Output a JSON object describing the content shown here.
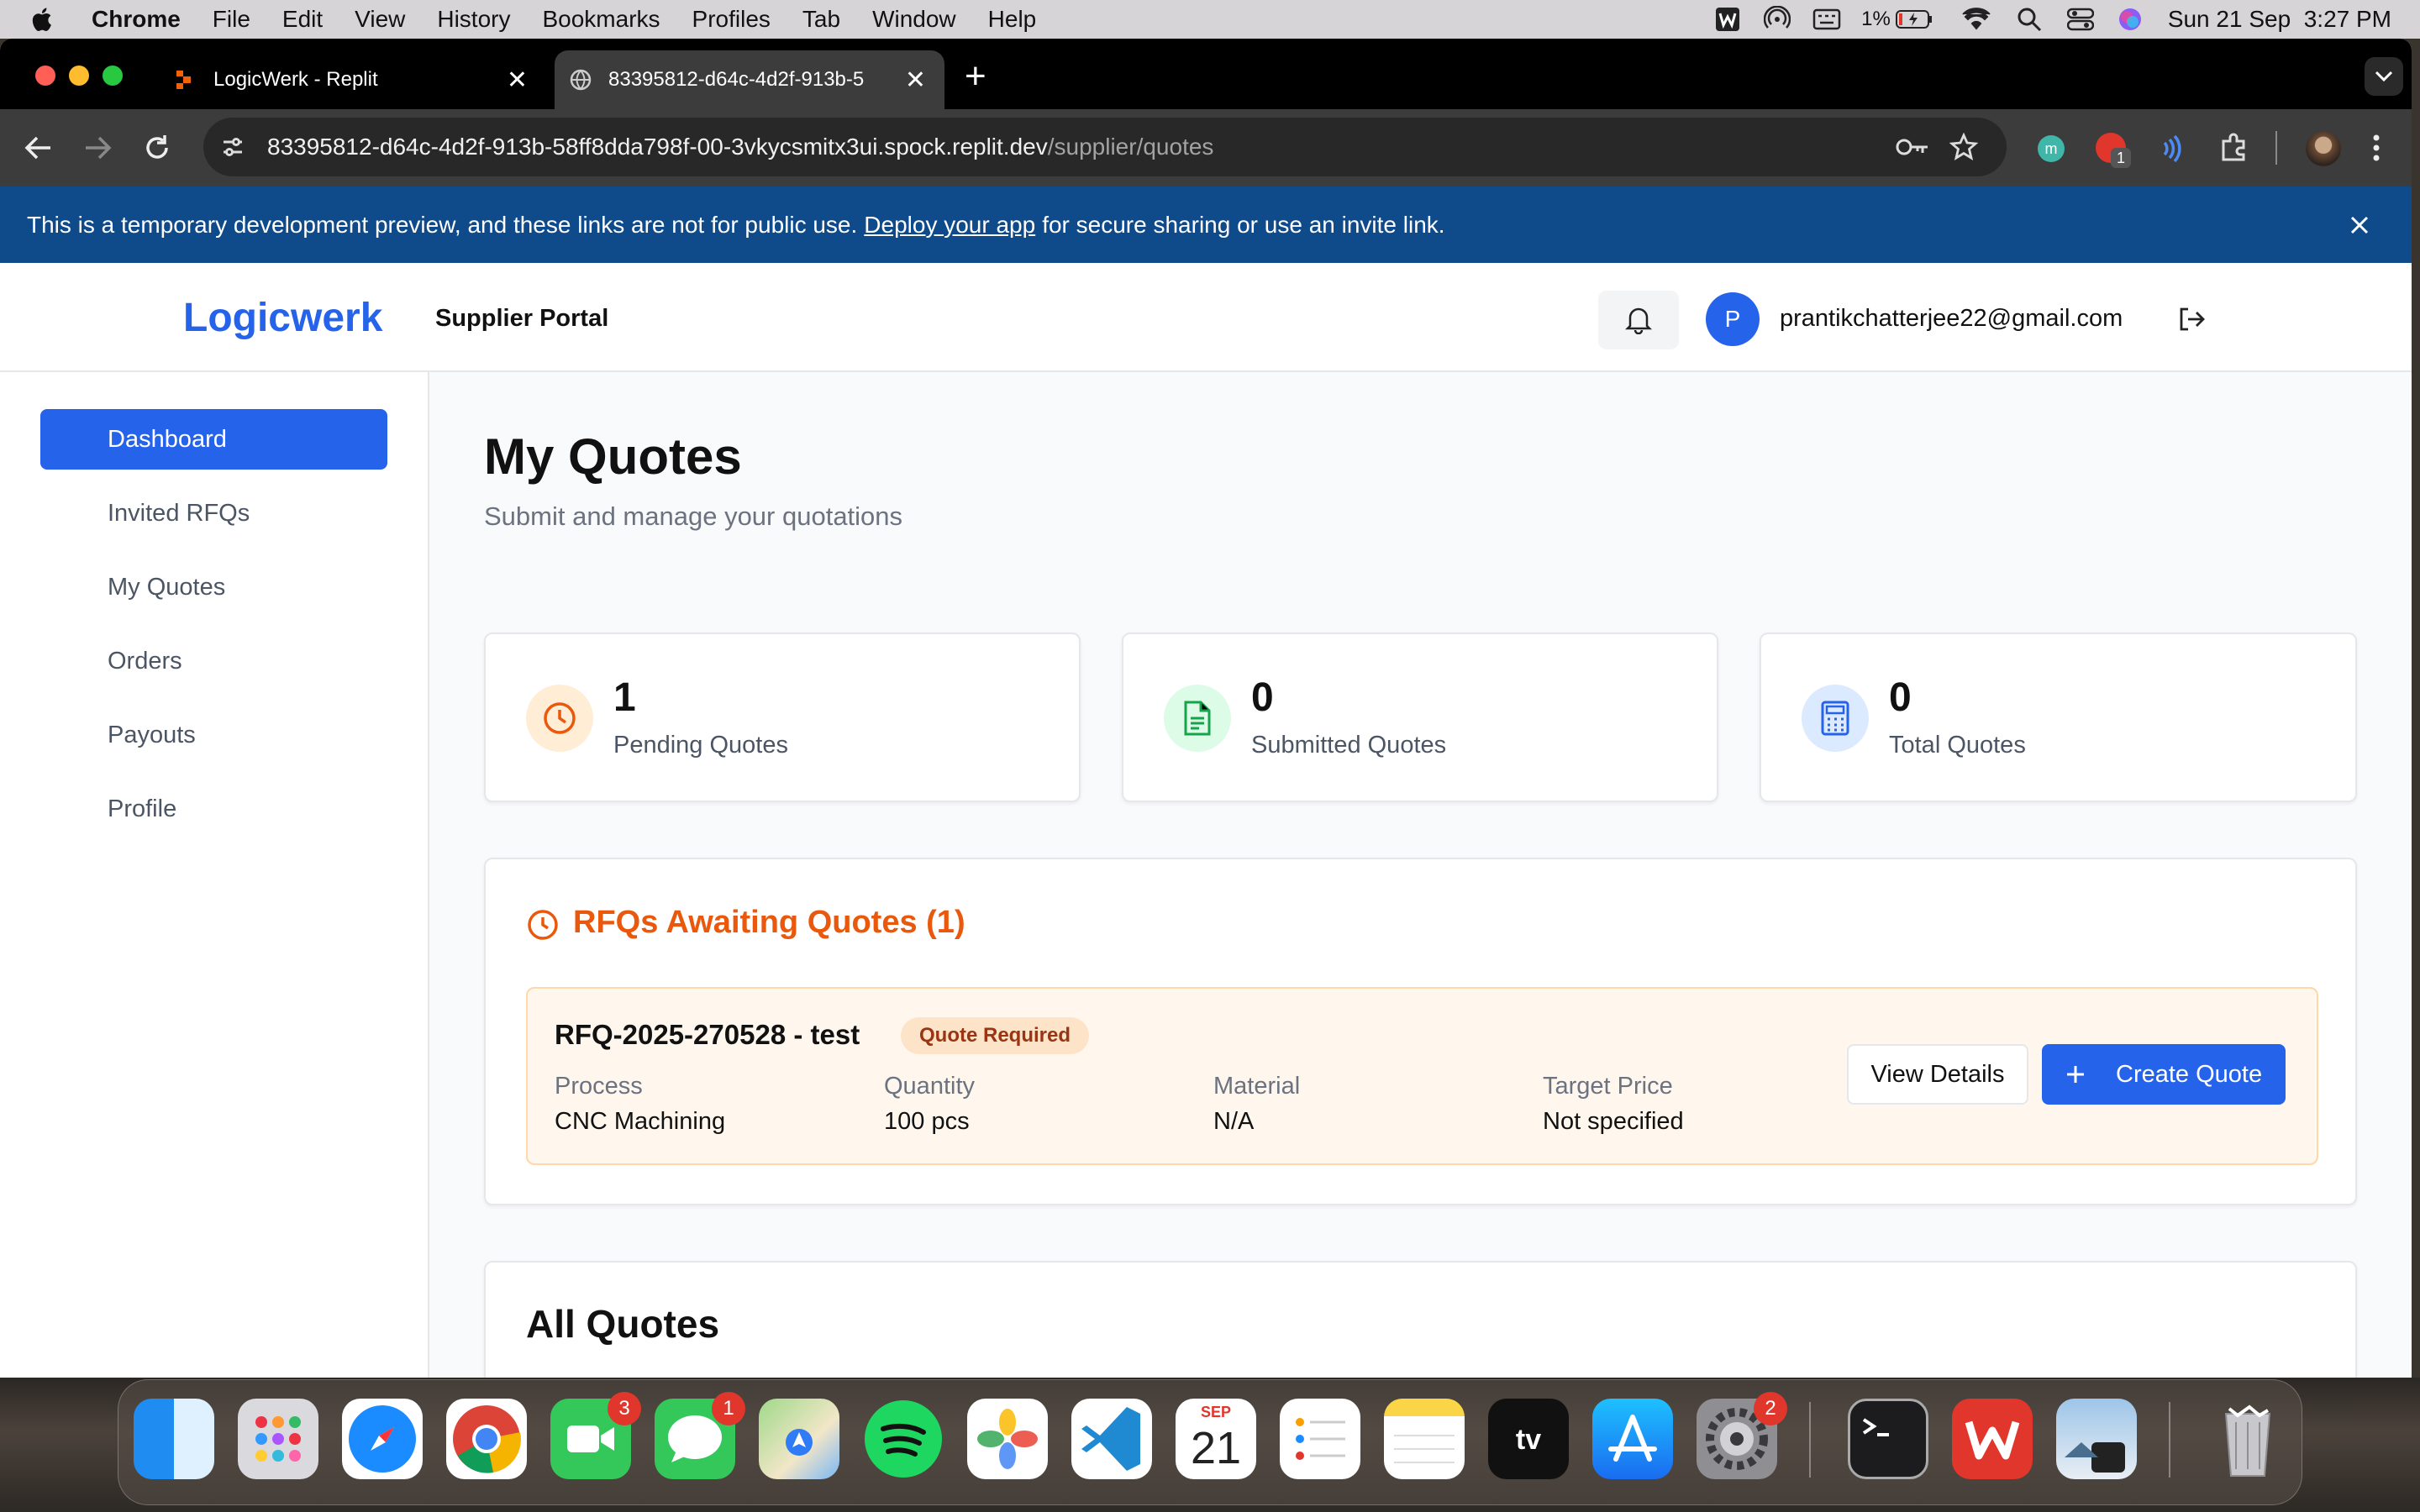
{
  "menubar": {
    "app": "Chrome",
    "items": [
      "File",
      "Edit",
      "View",
      "History",
      "Bookmarks",
      "Profiles",
      "Tab",
      "Window",
      "Help"
    ],
    "battery": "1%",
    "datetime": "Sun 21 Sep  3:27 PM"
  },
  "tabs": [
    {
      "title": "LogicWerk - Replit"
    },
    {
      "title": "83395812-d64c-4d2f-913b-5"
    }
  ],
  "url": {
    "host": "83395812-d64c-4d2f-913b-58ff8dda798f-00-3vkycsmitx3ui.spock.replit.dev",
    "path": "/supplier/quotes"
  },
  "ext_badge": "1",
  "banner": {
    "text_before": "This is a temporary development preview, and these links are not for public use.",
    "link": "Deploy your app",
    "text_after": "for secure sharing or use an invite link."
  },
  "header": {
    "brand": "Logicwerk",
    "portal": "Supplier Portal",
    "avatar": "P",
    "email": "prantikchatterjee22@gmail.com"
  },
  "sidebar": {
    "items": [
      {
        "label": "Dashboard",
        "active": true
      },
      {
        "label": "Invited RFQs"
      },
      {
        "label": "My Quotes"
      },
      {
        "label": "Orders"
      },
      {
        "label": "Payouts"
      },
      {
        "label": "Profile"
      }
    ]
  },
  "page": {
    "title": "My Quotes",
    "subtitle": "Submit and manage your quotations"
  },
  "stats": [
    {
      "value": "1",
      "label": "Pending Quotes",
      "color": "#ea580c"
    },
    {
      "value": "0",
      "label": "Submitted Quotes",
      "color": "#16a34a"
    },
    {
      "value": "0",
      "label": "Total Quotes",
      "color": "#2563eb"
    }
  ],
  "awaiting": {
    "title": "RFQs Awaiting Quotes (1)",
    "rfq": {
      "id": "RFQ-2025-270528 - test",
      "badge": "Quote Required",
      "fields": [
        {
          "label": "Process",
          "value": "CNC Machining"
        },
        {
          "label": "Quantity",
          "value": "100 pcs"
        },
        {
          "label": "Material",
          "value": "N/A"
        },
        {
          "label": "Target Price",
          "value": "Not specified"
        }
      ],
      "view_btn": "View Details",
      "create_btn": "Create Quote"
    }
  },
  "all_quotes": {
    "title": "All Quotes"
  },
  "dock": {
    "calendar_month": "SEP",
    "calendar_day": "21",
    "badges": {
      "facetime": "3",
      "messages": "1",
      "settings": "2"
    }
  }
}
